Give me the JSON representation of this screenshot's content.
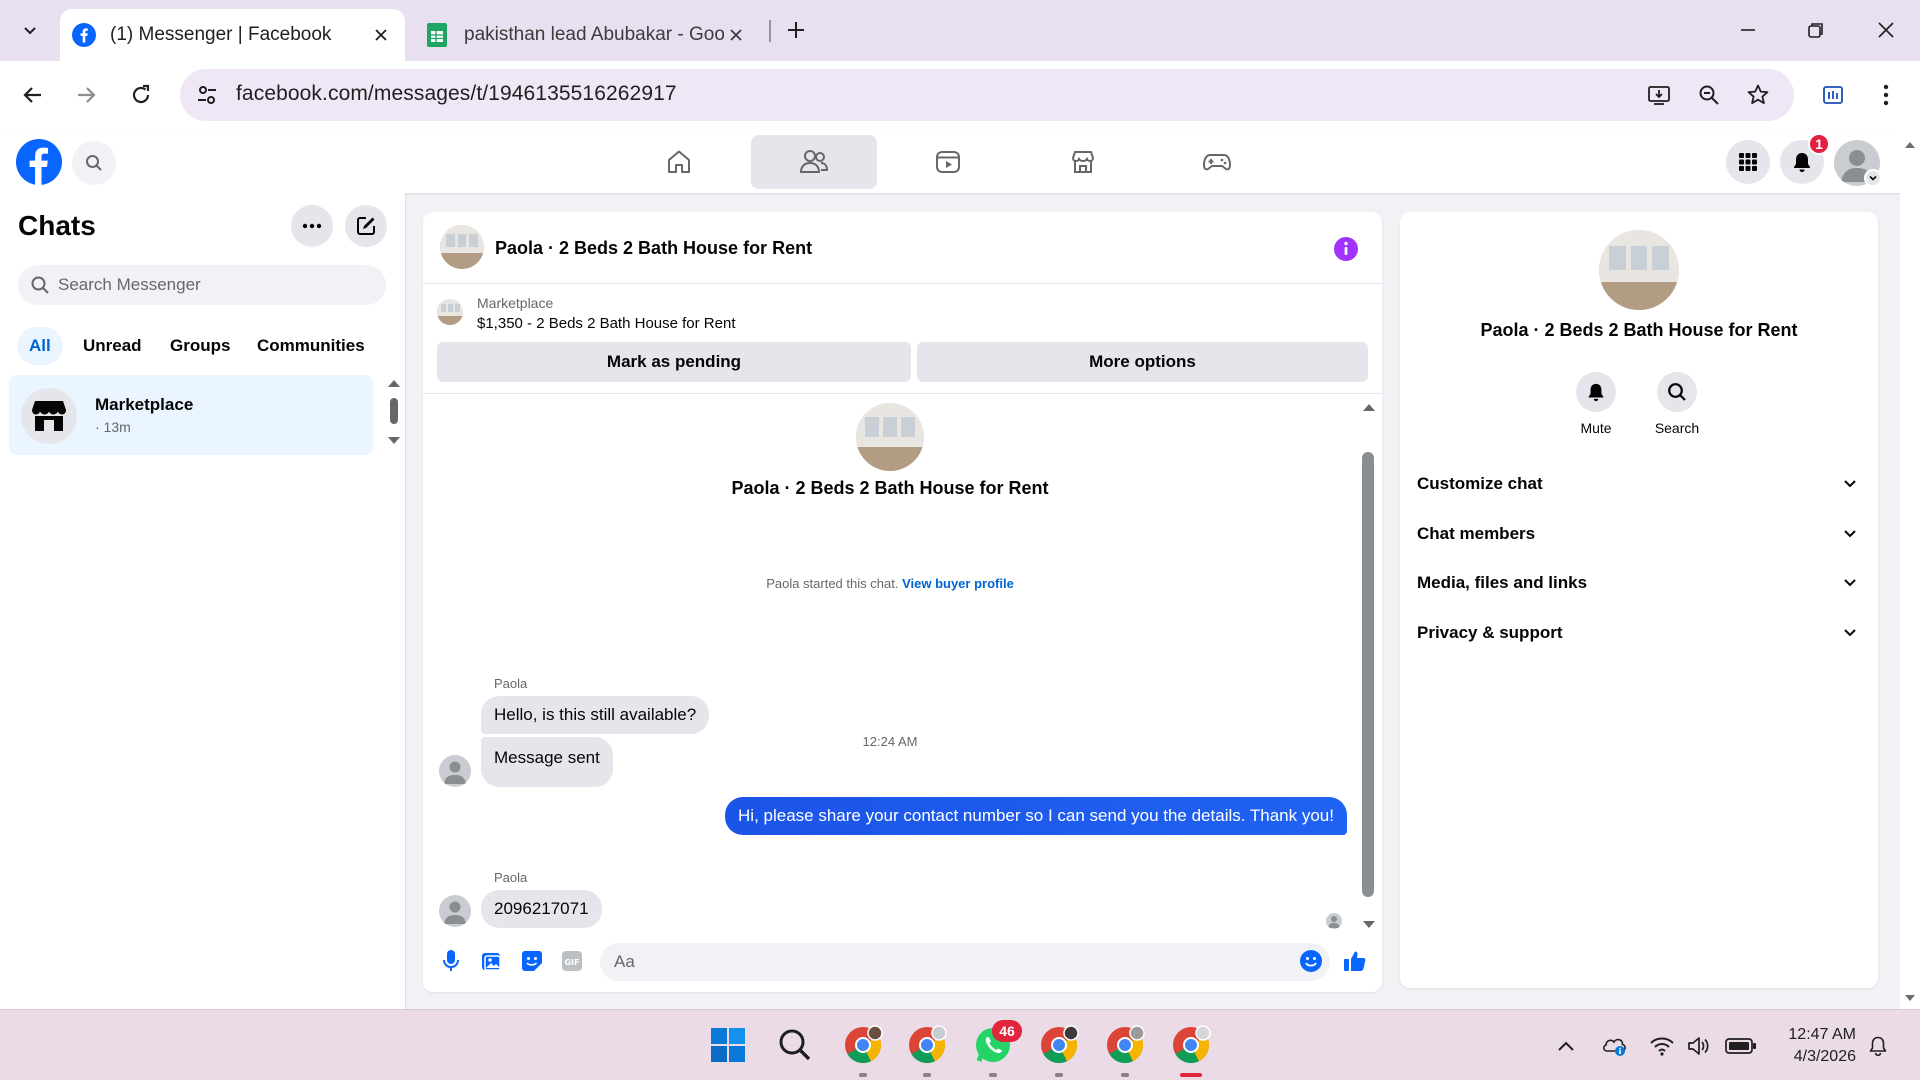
{
  "browser": {
    "tabs": [
      {
        "title": "(1) Messenger | Facebook",
        "active": true,
        "favicon": "facebook-icon"
      },
      {
        "title": "pakisthan lead Abubakar - Goo",
        "active": false,
        "favicon": "google-sheets-icon"
      }
    ],
    "url": "facebook.com/messages/t/1946135516262917",
    "toolbar_icons": [
      "back-icon",
      "forward-icon",
      "reload-icon",
      "site-settings-icon",
      "install-app-icon",
      "zoom-icon",
      "bookmark-star-icon",
      "extension-icon",
      "menu-icon"
    ],
    "window_controls": [
      "minimize-icon",
      "restore-icon",
      "close-icon"
    ]
  },
  "header": {
    "nav_tabs": [
      "home-icon",
      "friends-icon",
      "video-icon",
      "marketplace-icon",
      "gaming-icon"
    ],
    "selected_tab": "friends-icon",
    "notification_count": "1",
    "colors": {
      "brand": "#0866ff"
    }
  },
  "sidebar": {
    "title": "Chats",
    "search_placeholder": "Search Messenger",
    "filters": [
      "All",
      "Unread",
      "Groups",
      "Communities"
    ],
    "selected_filter": "All",
    "conversations": [
      {
        "name": "Marketplace",
        "time": "· 13m"
      }
    ]
  },
  "chat": {
    "title": "Paola · 2 Beds 2 Bath House for Rent",
    "marketplace": {
      "label": "Marketplace",
      "listing": "$1,350 - 2 Beds 2 Bath House for Rent",
      "mark_pending_label": "Mark as pending",
      "more_options_label": "More options"
    },
    "intro_name": "Paola · 2 Beds 2 Bath House for Rent",
    "system_text": "Paola started this chat.",
    "system_link": "View buyer profile",
    "messages": [
      {
        "sender": "Paola",
        "text": "Hello, is this still available?"
      },
      {
        "sender": "Paola",
        "text": "Message sent"
      },
      {
        "timestamp": "12:24 AM"
      },
      {
        "sender": "me",
        "text": "Hi, please share your contact number so I can send you the details. Thank you!"
      },
      {
        "sender": "Paola",
        "text": "2096217071"
      }
    ],
    "composer_placeholder": "Aa",
    "accent": "#0866ff"
  },
  "info_panel": {
    "name": "Paola · 2 Beds 2 Bath House for Rent",
    "actions": [
      {
        "icon": "bell-icon",
        "label": "Mute"
      },
      {
        "icon": "search-icon",
        "label": "Search"
      }
    ],
    "sections": [
      "Customize chat",
      "Chat members",
      "Media, files and links",
      "Privacy & support"
    ]
  },
  "taskbar": {
    "whatsapp_badge": "46",
    "time": "12:47 AM",
    "date": "4/3/2026"
  }
}
